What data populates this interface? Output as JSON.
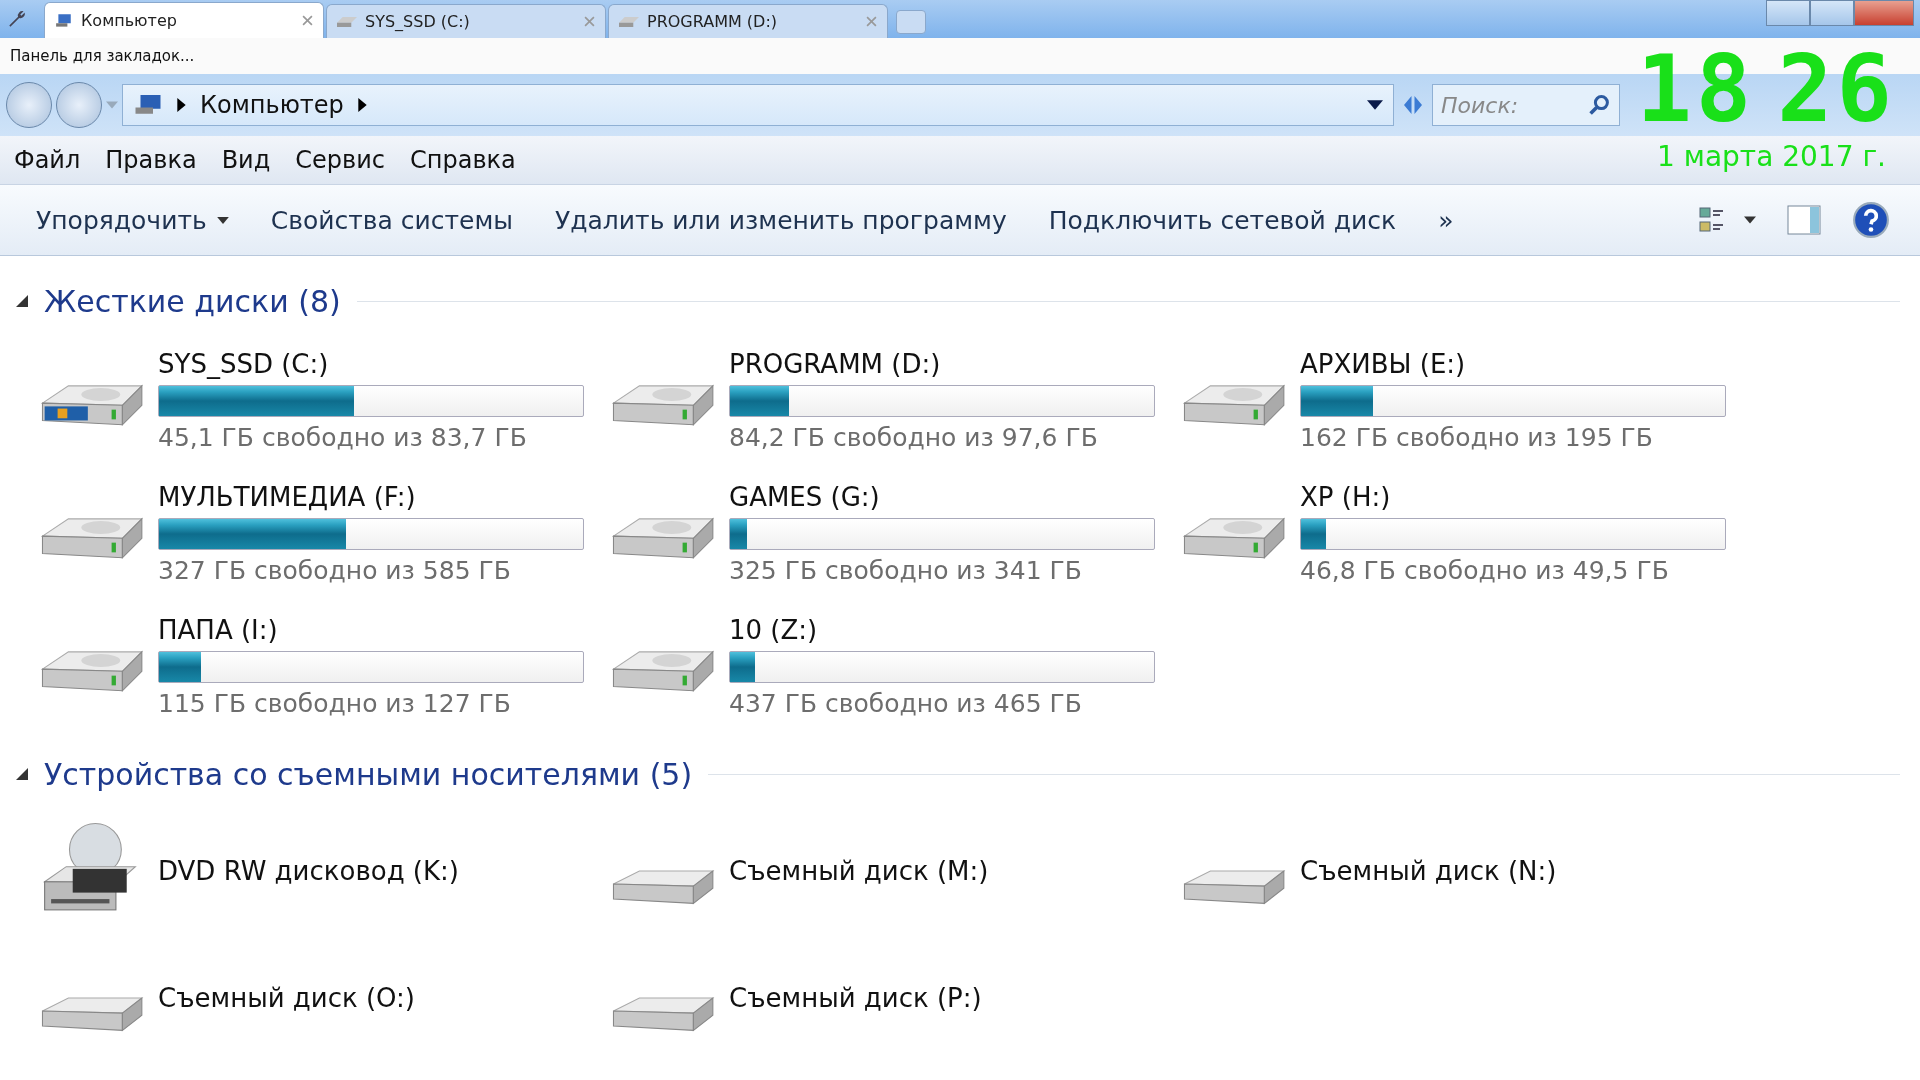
{
  "tabs": [
    {
      "label": "Компьютер",
      "selected": true,
      "kind": "computer"
    },
    {
      "label": "SYS_SSD (C:)",
      "selected": false,
      "kind": "drive"
    },
    {
      "label": "PROGRAMM (D:)",
      "selected": false,
      "kind": "drive"
    }
  ],
  "bookmarks_bar": {
    "label": "Панель для закладок..."
  },
  "address_bar": {
    "breadcrumb": "Компьютер"
  },
  "search": {
    "placeholder": "Поиск:"
  },
  "clock": {
    "hours": "18",
    "minutes": "26",
    "date": "1 марта 2017 г."
  },
  "menu": [
    "Файл",
    "Правка",
    "Вид",
    "Сервис",
    "Справка"
  ],
  "toolbar": [
    {
      "label": "Упорядочить",
      "dropdown": true
    },
    {
      "label": "Свойства системы",
      "dropdown": false
    },
    {
      "label": "Удалить или изменить программу",
      "dropdown": false
    },
    {
      "label": "Подключить сетевой диск",
      "dropdown": false
    },
    {
      "label": "»",
      "dropdown": false
    }
  ],
  "sections": [
    {
      "title": "Жесткие диски (8)",
      "expanded": true,
      "items": [
        {
          "name": "SYS_SSD (C:)",
          "kind": "system",
          "level": 0.46,
          "info": "45,1 ГБ свободно из 83,7 ГБ"
        },
        {
          "name": "PROGRAMM (D:)",
          "kind": "hdd",
          "level": 0.14,
          "info": "84,2 ГБ свободно из 97,6 ГБ"
        },
        {
          "name": "АРХИВЫ (E:)",
          "kind": "hdd",
          "level": 0.17,
          "info": "162 ГБ свободно из 195 ГБ"
        },
        {
          "name": "МУЛЬТИМЕДИА (F:)",
          "kind": "hdd",
          "level": 0.44,
          "info": "327 ГБ свободно из 585 ГБ"
        },
        {
          "name": "GAMES (G:)",
          "kind": "hdd",
          "level": 0.04,
          "info": "325 ГБ свободно из 341 ГБ"
        },
        {
          "name": "XP (H:)",
          "kind": "hdd",
          "level": 0.06,
          "info": "46,8 ГБ свободно из 49,5 ГБ"
        },
        {
          "name": "ПАПА (I:)",
          "kind": "hdd",
          "level": 0.1,
          "info": "115 ГБ свободно из 127 ГБ"
        },
        {
          "name": "10 (Z:)",
          "kind": "hdd",
          "level": 0.06,
          "info": "437 ГБ свободно из 465 ГБ"
        }
      ]
    },
    {
      "title": "Устройства со съемными носителями (5)",
      "expanded": true,
      "items": [
        {
          "name": "DVD RW дисковод (K:)",
          "kind": "dvd"
        },
        {
          "name": "Съемный диск (M:)",
          "kind": "removable"
        },
        {
          "name": "Съемный диск (N:)",
          "kind": "removable"
        },
        {
          "name": "Съемный диск (O:)",
          "kind": "removable"
        },
        {
          "name": "Съемный диск (P:)",
          "kind": "removable"
        }
      ]
    }
  ]
}
